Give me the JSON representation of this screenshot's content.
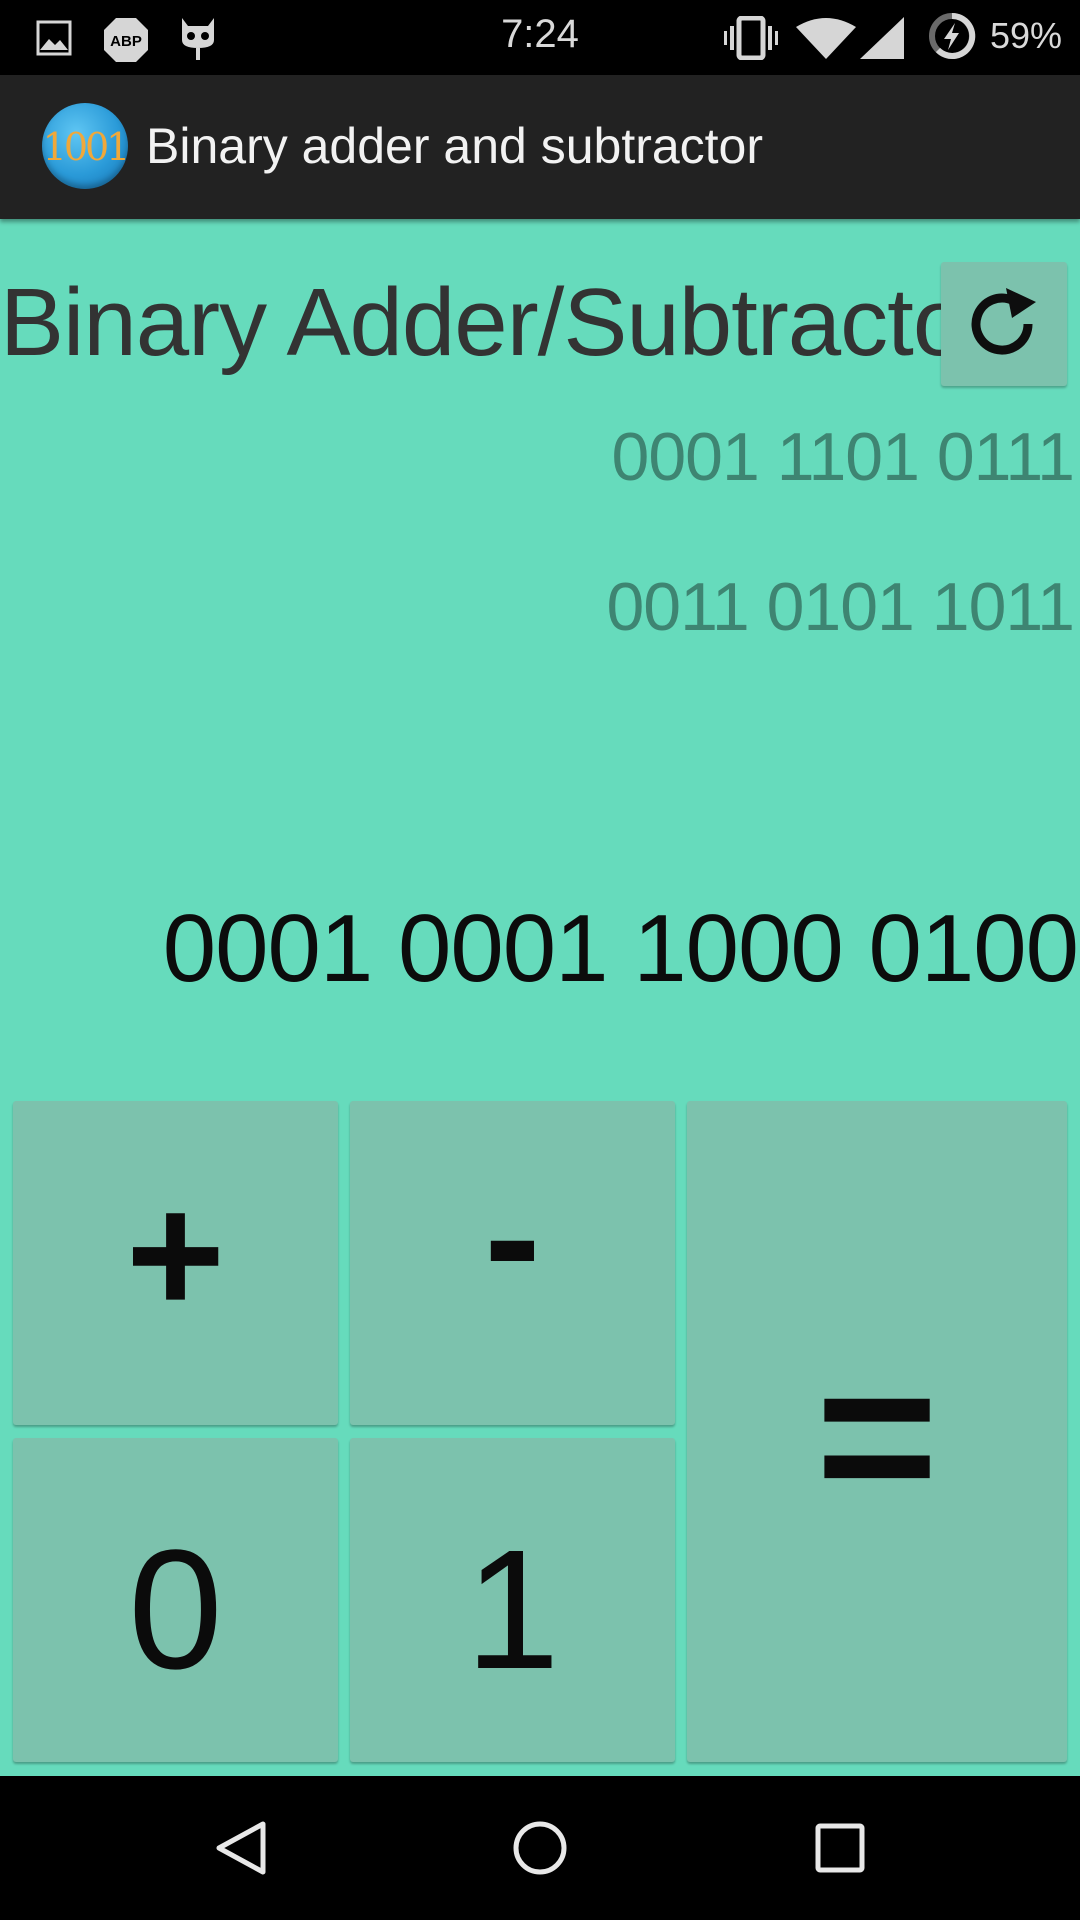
{
  "status_bar": {
    "time": "7:24",
    "battery": "59%",
    "abp_label": "ABP",
    "icons": [
      "image-icon",
      "adblock-icon",
      "cyanogen-icon",
      "vibrate-icon",
      "wifi-icon",
      "signal-icon",
      "battery-charging-icon"
    ]
  },
  "action_bar": {
    "logo_text": "1001",
    "title": "Binary adder and subtractor"
  },
  "content": {
    "heading": "Binary Adder/Subtractor",
    "refresh_icon": "refresh-icon",
    "operand_a": "0001 1101 0111",
    "operand_b": "0011 0101 1011",
    "result": "0001 0001 1000 0100"
  },
  "keypad": {
    "plus": "+",
    "minus": "-",
    "zero": "0",
    "one": "1",
    "equals": "="
  },
  "nav_bar": {
    "icons": [
      "back-icon",
      "home-icon",
      "recents-icon"
    ]
  },
  "colors": {
    "background": "#66dbbc",
    "key": "#7cc2ad",
    "operand_text": "#3e8572",
    "action_bar": "#222222"
  }
}
